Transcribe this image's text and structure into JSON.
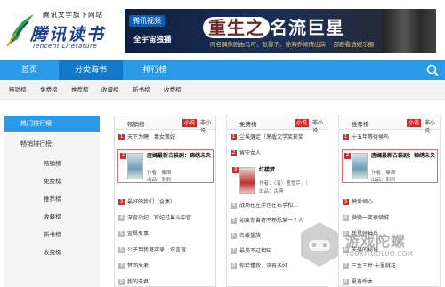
{
  "header": {
    "logo_slogan": "腾讯文学旗下网站",
    "logo_main": "腾讯读书",
    "logo_en": "Tencent Literature",
    "banner": {
      "brand": "腾讯视频",
      "sub": "全宇宙独播",
      "title_a": "重生之",
      "title_b": "名流巨星",
      "desc": "同名偶像剧由马可、张馨予、徐海乔倾情出演    一部剧看透娱乐圈"
    }
  },
  "nav": {
    "items": [
      {
        "label": "首页",
        "active": false
      },
      {
        "label": "分类海书",
        "active": true
      },
      {
        "label": "排行榜",
        "active": false
      }
    ]
  },
  "subnav": {
    "items": [
      "畅销榜",
      "免费榜",
      "推荐榜",
      "收藏榜",
      "新书榜",
      "收费榜"
    ]
  },
  "sidebar": {
    "heading": "热门排行榜",
    "subheading": "畅销排行榜",
    "items": [
      "畅销榜",
      "免费榜",
      "推荐榜",
      "收藏榜",
      "新书榜",
      "收费榜"
    ]
  },
  "columns": [
    {
      "title": "畅销榜",
      "tab_active": "小说",
      "tab_inactive": "非小说",
      "rows": [
        {
          "rank": "1",
          "text": "天下为聘：毒女策妃"
        },
        {
          "rank": "3",
          "text": "最好的我们（全集）"
        },
        {
          "rank": "4",
          "text": "深宫战纪：官妃过巢斗中宫"
        },
        {
          "rank": "5",
          "text": "宜昌鬼事"
        },
        {
          "rank": "6",
          "text": "公子到我鬼实录：说言谊"
        },
        {
          "rank": "7",
          "text": "梦回关考"
        },
        {
          "rank": "8",
          "text": "我的夫君"
        }
      ],
      "feature": {
        "rank": "2",
        "title": "唐嫣最新古装剧：锦绣未央",
        "author": "作者：秦简",
        "extra": "出品：刺刺"
      }
    },
    {
      "title": "免费榜",
      "tab_active": "小说",
      "tab_inactive": "非小说",
      "rows": [
        {
          "rank": "1",
          "text": "尘埃落定（茅盾文学奖获奖"
        },
        {
          "rank": "2",
          "text": "留守女人"
        },
        {
          "rank": "4",
          "text": "战场在左手也在右手和…"
        },
        {
          "rank": "5",
          "text": "如果你曾将不熟悉某一个人"
        },
        {
          "rank": "6",
          "text": "名媛望族"
        },
        {
          "rank": "7",
          "text": "最美不过相知"
        },
        {
          "rank": "8",
          "text": "你若懂我，该有多好"
        }
      ],
      "feature": {
        "rank": "3",
        "title": "红楼梦",
        "author": "作者：（清）曹雪芹，（",
        "extra": "出品：古典"
      }
    },
    {
      "title": "推荐榜",
      "tab_active": "小说",
      "tab_inactive": "非小说",
      "rows": [
        {
          "rank": "1",
          "text": "十五年等待候鸟"
        },
        {
          "rank": "3",
          "text": "触爱倾心"
        },
        {
          "rank": "4",
          "text": "微微一笑很倾城"
        },
        {
          "rank": "5",
          "text": "我是特种兵"
        },
        {
          "rank": "6",
          "text": "失落的秘境"
        },
        {
          "rank": "7",
          "text": "三生三世·十里桃花"
        },
        {
          "rank": "8",
          "text": "夏有乔木"
        }
      ],
      "feature": {
        "rank": "2",
        "title": "唐嫣最新古装剧：锦绣未央",
        "author": "作者：秦简",
        "extra": "出品：刺刺"
      }
    }
  ],
  "watermark": {
    "cn": "游戏陀螺",
    "en": "YOUXITUOLUO.COM"
  },
  "colors": {
    "nav_blue": "#2b9ae6",
    "nav_active": "#1378c7",
    "accent_red": "#c9302c",
    "logo_blue": "#1d3f8c"
  }
}
